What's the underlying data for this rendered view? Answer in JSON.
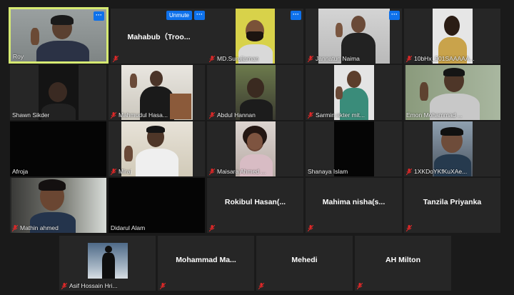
{
  "meeting": {
    "tiles": [
      {
        "name": "Roy",
        "more": "···"
      },
      {
        "name": "Mahabub（Troo...",
        "unmute": "Unmute",
        "more": "···"
      },
      {
        "name": "MD.Surujjaman",
        "more": "···"
      },
      {
        "name": "Jannatun Naima",
        "more": "···"
      },
      {
        "name": "10bHx_901SAAAAA..."
      },
      {
        "name": "Shawn Sikder"
      },
      {
        "name": "Mahmudul Hasa..."
      },
      {
        "name": "Abdul Hannan"
      },
      {
        "name": "Sarmin akter mit..."
      },
      {
        "name": "Emon Mohammad ..."
      },
      {
        "name": "Afroja"
      },
      {
        "name": "Miraj"
      },
      {
        "name": "Maisara Ahmed ..."
      },
      {
        "name": "Shanaya Islam"
      },
      {
        "name": "1XKDoYKfKuXAe..."
      },
      {
        "name": "Mathin ahmed"
      },
      {
        "name": "Didarul Alam"
      },
      {
        "name": "Rokibul  Hasan(..."
      },
      {
        "name": "Mahima  nisha(s..."
      },
      {
        "name": "Tanzila Priyanka"
      },
      {
        "name": "Asif Hossain Hri..."
      },
      {
        "name": "Mohammad   Ma..."
      },
      {
        "name": "Mehedi"
      },
      {
        "name": "AH Milton"
      }
    ]
  },
  "colors": {
    "active_border": "#d6ea72",
    "accent": "#0e71eb",
    "muted_mic": "#e02828"
  },
  "icons": {
    "mic_muted": "mic-muted-icon",
    "more": "more-options-icon"
  }
}
